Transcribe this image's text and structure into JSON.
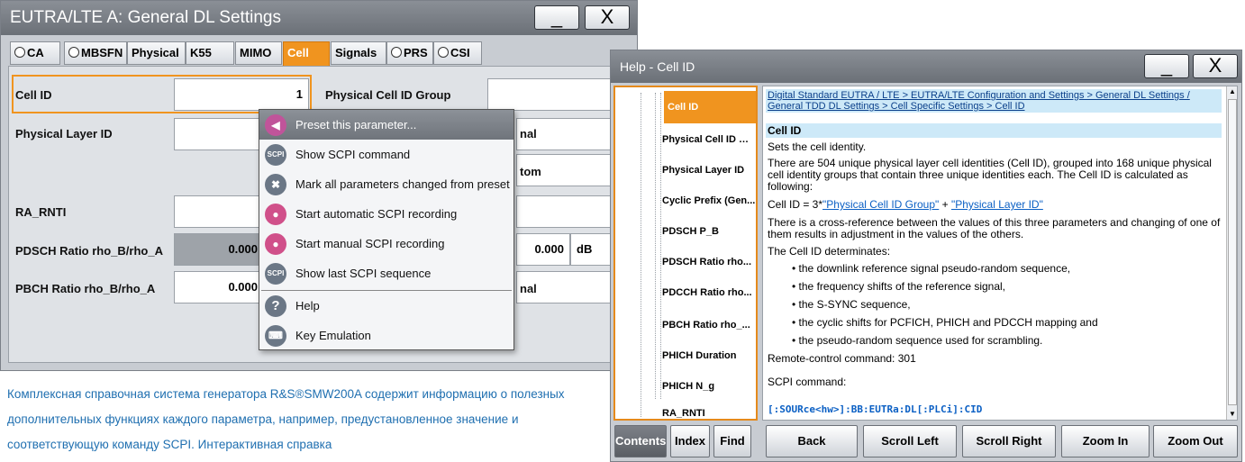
{
  "left_window": {
    "title": "EUTRA/LTE A: General DL Settings",
    "minimize": "_",
    "close": "X",
    "tabs": [
      {
        "label": "CA",
        "radio": true
      },
      {
        "label": "MBSFN",
        "radio": true
      },
      {
        "label": "Physical",
        "radio": false
      },
      {
        "label": "K55",
        "radio": false
      },
      {
        "label": "MIMO",
        "radio": false
      },
      {
        "label": "Cell",
        "radio": false,
        "active": true
      },
      {
        "label": "Signals",
        "radio": false
      },
      {
        "label": "PRS",
        "radio": true
      },
      {
        "label": "CSI",
        "radio": true
      }
    ],
    "fields": {
      "cell_id_label": "Cell ID",
      "cell_id_value": "1",
      "phys_cell_group_label": "Physical Cell ID Group",
      "phys_layer_id_label": "Physical Layer ID",
      "partial_label_1": "nal",
      "partial_label_2": "tom",
      "ra_rnti_label": "RA_RNTI",
      "pdsch_label": "PDSCH Ratio rho_B/rho_A",
      "pdsch_value": "0.000",
      "pdsch_value_right": "0.000",
      "pdsch_unit": "dB",
      "pbch_label": "PBCH Ratio rho_B/rho_A",
      "pbch_value": "0.000",
      "partial_label_3": "nal"
    },
    "context_menu": [
      {
        "label": "Preset this parameter...",
        "icon": "preset-arrow-icon",
        "color": "#c0549a"
      },
      {
        "label": "Show SCPI command",
        "icon": "scpi-icon",
        "color": "#6b7786"
      },
      {
        "label": "Mark all parameters changed from preset",
        "icon": "x-mark-icon",
        "color": "#6b7786"
      },
      {
        "label": "Start automatic SCPI recording",
        "icon": "record-auto-icon",
        "color": "#d0508a"
      },
      {
        "label": "Start manual SCPI recording",
        "icon": "record-manual-icon",
        "color": "#d0508a"
      },
      {
        "label": "Show last SCPI sequence",
        "icon": "scpi-sequence-icon",
        "color": "#6b7786"
      },
      {
        "label": "Help",
        "icon": "help-icon",
        "color": "#6b7786"
      },
      {
        "label": "Key Emulation",
        "icon": "keyboard-icon",
        "color": "#6b7786"
      }
    ]
  },
  "caption": "Комплексная справочная система генератора R&S®SMW200A содержит информацию о полезных дополнительных функциях каждого параметра, например, предустановленное значение и соответствующую команду SCPI. Интерактивная справка",
  "right_window": {
    "title": "Help - Cell ID",
    "minimize": "_",
    "close": "X",
    "toc": [
      "Cell ID",
      "Physical Cell ID Gr...",
      "Physical Layer ID",
      "Cyclic Prefix (Gen...",
      "PDSCH P_B",
      "PDSCH Ratio rho...",
      "PDCCH Ratio rho...",
      "PBCH Ratio rho_...",
      "PHICH Duration",
      "PHICH N_g",
      "RA_RNTI"
    ],
    "breadcrumb": "Digital Standard EUTRA / LTE > EUTRA/LTE Configuration and Settings > General DL Settings / General TDD DL Settings > Cell Specific Settings > Cell ID",
    "heading": "Cell ID",
    "p1": "Sets the cell identity.",
    "p2": "There are 504 unique physical layer cell identities (Cell ID), grouped into 168 unique physical cell identity groups that contain three unique identities each. The Cell ID is calculated as following:",
    "formula_prefix": "Cell ID = 3*",
    "formula_link1": "\"Physical Cell ID Group\"",
    "formula_plus": " + ",
    "formula_link2": "\"Physical Layer ID\"",
    "p3": "There is a cross-reference between the values of this three parameters and changing of one of them results in adjustment in the values of the others.",
    "p4": "The Cell ID determinates:",
    "bullets": [
      "the downlink reference signal pseudo-random sequence,",
      "the frequency shifts of the reference signal,",
      "the S-SYNC sequence,",
      "the cyclic shifts for PCFICH, PHICH and PDCCH mapping and",
      "the pseudo-random sequence used for scrambling."
    ],
    "remote": "Remote-control command: 301",
    "scpi_label": "SCPI command:",
    "scpi_cmd": "[:SOURce<hw>]:BB:EUTRa:DL[:PLCi]:CID",
    "buttons": [
      "Contents",
      "Index",
      "Find",
      "Back",
      "Scroll Left",
      "Scroll Right",
      "Zoom In",
      "Zoom Out"
    ]
  },
  "colors": {
    "accent_orange": "#f0941f",
    "link_blue": "#0a5fc4",
    "help_highlight": "#cde9f8",
    "caption_blue": "#1f6fb0"
  }
}
